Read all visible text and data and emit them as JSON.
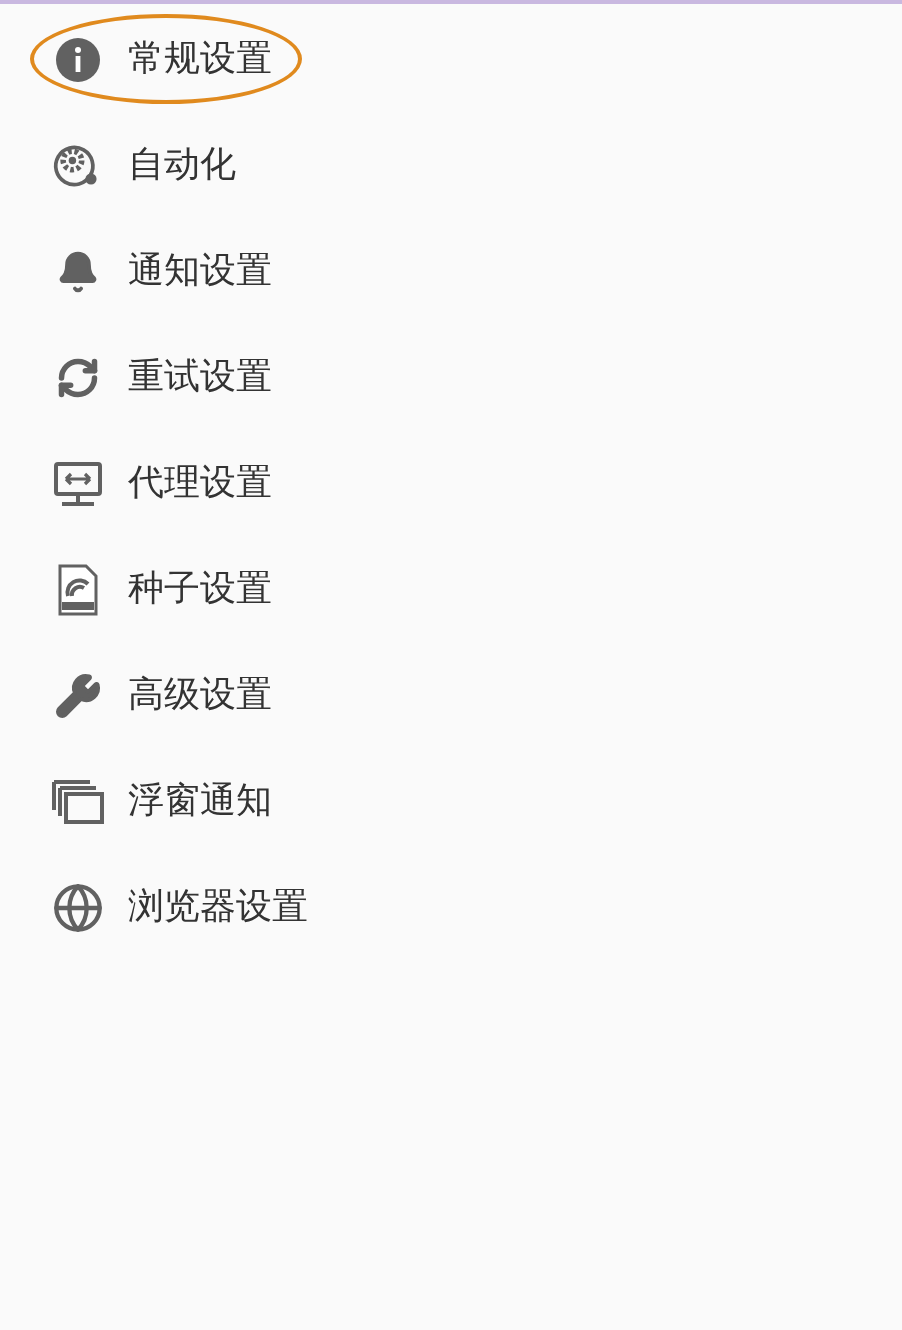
{
  "menu": {
    "items": [
      {
        "label": "常规设置",
        "kind": "info",
        "selected": true
      },
      {
        "label": "自动化",
        "kind": "automation",
        "selected": false
      },
      {
        "label": "通知设置",
        "kind": "bell",
        "selected": false
      },
      {
        "label": "重试设置",
        "kind": "retry",
        "selected": false
      },
      {
        "label": "代理设置",
        "kind": "proxy",
        "selected": false
      },
      {
        "label": "种子设置",
        "kind": "torrent",
        "selected": false
      },
      {
        "label": "高级设置",
        "kind": "tools",
        "selected": false
      },
      {
        "label": "浮窗通知",
        "kind": "windows",
        "selected": false
      },
      {
        "label": "浏览器设置",
        "kind": "browser",
        "selected": false
      }
    ]
  }
}
